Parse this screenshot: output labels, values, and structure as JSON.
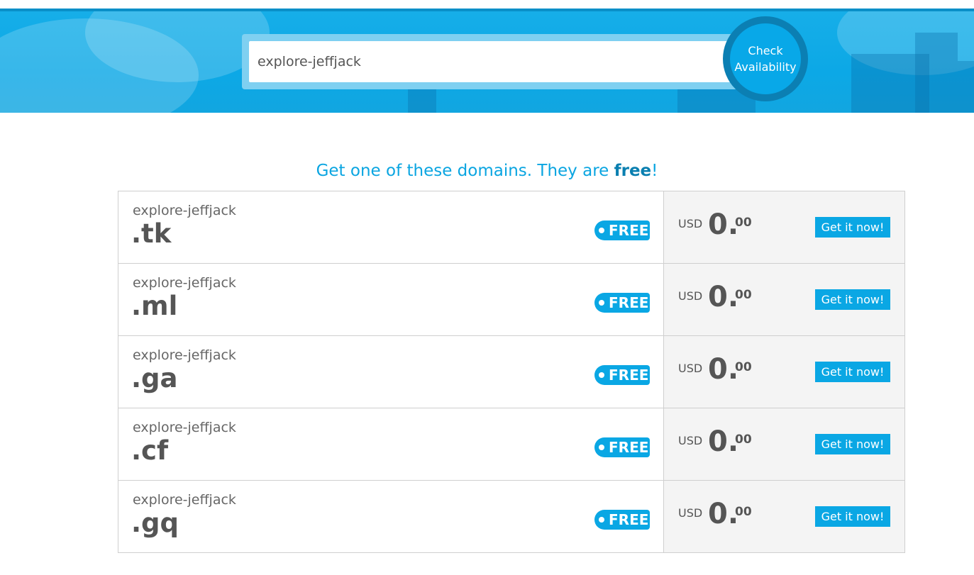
{
  "search": {
    "value": "explore-jeffjack",
    "button_line1": "Check",
    "button_line2": "Availability"
  },
  "headline": {
    "prefix": "Get one of these domains. They are ",
    "emphasis": "free",
    "suffix": "!"
  },
  "domains": [
    {
      "name": "explore-jeffjack",
      "tld": ".tk",
      "badge": "FREE",
      "currency": "USD",
      "price_int": "0.",
      "price_cents": "00",
      "button": "Get it now!"
    },
    {
      "name": "explore-jeffjack",
      "tld": ".ml",
      "badge": "FREE",
      "currency": "USD",
      "price_int": "0.",
      "price_cents": "00",
      "button": "Get it now!"
    },
    {
      "name": "explore-jeffjack",
      "tld": ".ga",
      "badge": "FREE",
      "currency": "USD",
      "price_int": "0.",
      "price_cents": "00",
      "button": "Get it now!"
    },
    {
      "name": "explore-jeffjack",
      "tld": ".cf",
      "badge": "FREE",
      "currency": "USD",
      "price_int": "0.",
      "price_cents": "00",
      "button": "Get it now!"
    },
    {
      "name": "explore-jeffjack",
      "tld": ".gq",
      "badge": "FREE",
      "currency": "USD",
      "price_int": "0.",
      "price_cents": "00",
      "button": "Get it now!"
    }
  ],
  "colors": {
    "accent": "#0aa7e4",
    "hero": "#12a6e0",
    "text": "#555555"
  }
}
